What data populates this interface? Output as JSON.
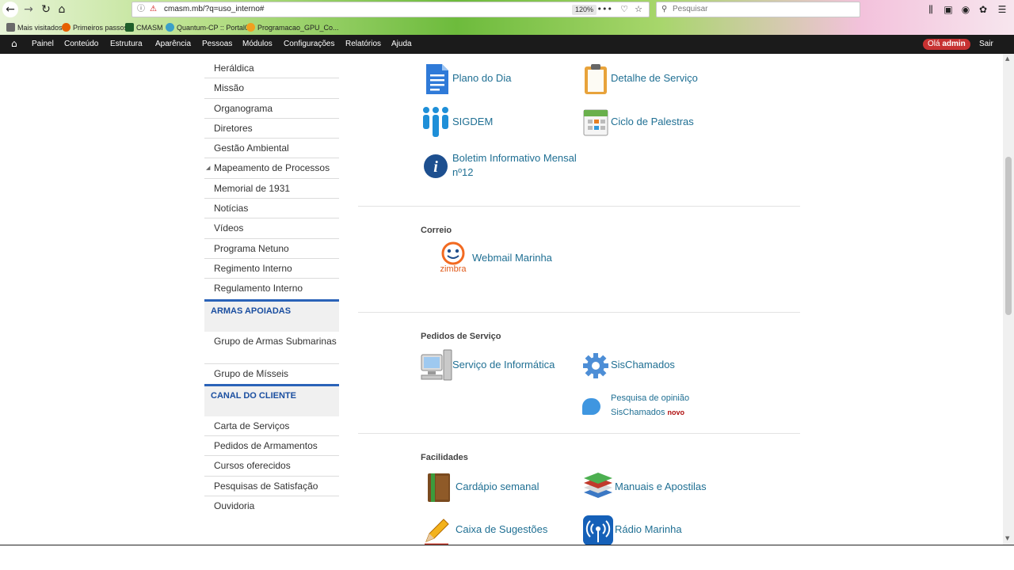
{
  "browser": {
    "url": "cmasm.mb/?q=uso_interno#",
    "zoom": "120%",
    "search_placeholder": "Pesquisar",
    "bookmarks": [
      "Mais visitados",
      "Primeiros passos",
      "CMASM",
      "Quantum-CP :: Portal0",
      "Programacao_GPU_Co..."
    ]
  },
  "admin_bar": {
    "items": [
      "Painel",
      "Conteúdo",
      "Estrutura",
      "Aparência",
      "Pessoas",
      "Módulos",
      "Configurações",
      "Relatórios",
      "Ajuda"
    ],
    "hello_prefix": "Olá",
    "user": "admin",
    "logout": "Sair"
  },
  "sidebar": {
    "group1": [
      "Heráldica",
      "Missão",
      "Organograma",
      "Diretores",
      "Gestão Ambiental",
      "Mapeamento de Processos",
      "Memorial de 1931",
      "Notícias",
      "Vídeos",
      "Programa Netuno",
      "Regimento Interno",
      "Regulamento Interno"
    ],
    "armas_title": "ARMAS APOIADAS",
    "armas": [
      "Grupo de Armas Submarinas",
      "Grupo de Mísseis"
    ],
    "canal_title": "CANAL DO CLIENTE",
    "canal": [
      "Carta de Serviços",
      "Pedidos de Armamentos",
      "Cursos oferecidos",
      "Pesquisas de Satisfação",
      "Ouvidoria"
    ]
  },
  "main": {
    "top_links": {
      "plano": "Plano do Dia",
      "detalhe": "Detalhe de Serviço",
      "sigdem": "SIGDEM",
      "ciclo": "Ciclo de Palestras",
      "boletim_1": "Boletim Informativo Mensal",
      "boletim_2": "nº12"
    },
    "correio": {
      "title": "Correio",
      "webmail": "Webmail Marinha",
      "zimbra": "zimbra"
    },
    "pedidos": {
      "title": "Pedidos de Serviço",
      "informatica": "Serviço de Informática",
      "sischamados": "SisChamados",
      "pesquisa_1": "Pesquisa de opinião",
      "pesquisa_2": "SisChamados",
      "novo": "novo"
    },
    "facilidades": {
      "title": "Facilidades",
      "cardapio": "Cardápio semanal",
      "manuais": "Manuais e Apostilas",
      "caixa": "Caixa de Sugestões",
      "radio": "Rádio Marinha"
    }
  },
  "colors": {
    "link": "#1f6f93",
    "admin_bar": "#1b1b1b",
    "hello_badge": "#c73232",
    "sidebar_heading": "#1a4ea0",
    "sidebar_accent": "#2a63b8"
  }
}
